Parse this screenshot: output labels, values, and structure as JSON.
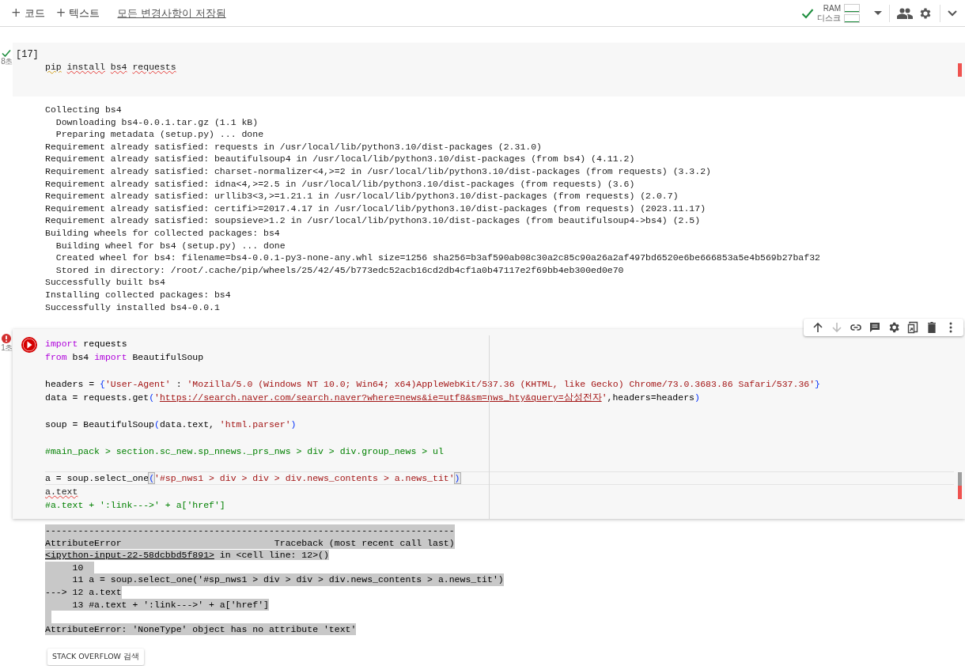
{
  "toolbar": {
    "buttons": [
      {
        "icon": "+",
        "label": "코드"
      },
      {
        "icon": "+",
        "label": "텍스트"
      }
    ],
    "save_status": "모든 변경사항이 저장됨",
    "resources": {
      "connected": true,
      "meters": [
        {
          "label": "RAM"
        },
        {
          "label": "디스크"
        }
      ]
    }
  },
  "cells": [
    {
      "failed": false,
      "time": "8초",
      "execution_count": "[17]",
      "run_button": false,
      "toolbar": false,
      "lines": [
        {
          "kind": "code",
          "current": false,
          "tokens": [
            {
              "kind": "warn",
              "text": "pip"
            },
            {
              "kind": "typo",
              "text": "install",
              "space_before": true
            },
            {
              "kind": "typo",
              "text": "bs4",
              "space_before": true
            },
            {
              "kind": "typo",
              "text": "requests",
              "space_before": true
            }
          ]
        }
      ],
      "output": {
        "kind": "stream",
        "lines": [
          "Collecting bs4",
          "  Downloading bs4-0.0.1.tar.gz (1.1 kB)",
          "  Preparing metadata (setup.py) ... done",
          "Requirement already satisfied: requests in /usr/local/lib/python3.10/dist-packages (2.31.0)",
          "Requirement already satisfied: beautifulsoup4 in /usr/local/lib/python3.10/dist-packages (from bs4) (4.11.2)",
          "Requirement already satisfied: charset-normalizer<4,>=2 in /usr/local/lib/python3.10/dist-packages (from requests) (3.3.2)",
          "Requirement already satisfied: idna<4,>=2.5 in /usr/local/lib/python3.10/dist-packages (from requests) (3.6)",
          "Requirement already satisfied: urllib3<3,>=1.21.1 in /usr/local/lib/python3.10/dist-packages (from requests) (2.0.7)",
          "Requirement already satisfied: certifi>=2017.4.17 in /usr/local/lib/python3.10/dist-packages (from requests) (2023.11.17)",
          "Requirement already satisfied: soupsieve>1.2 in /usr/local/lib/python3.10/dist-packages (from beautifulsoup4->bs4) (2.5)",
          "Building wheels for collected packages: bs4",
          "  Building wheel for bs4 (setup.py) ... done",
          "  Created wheel for bs4: filename=bs4-0.0.1-py3-none-any.whl size=1256 sha256=b3af590ab08c30a2c85c90a26a2af497bd6520e6be666853a5e4b569b27baf32",
          "  Stored in directory: /root/.cache/pip/wheels/25/42/45/b773edc52acb16cd2db4cf1a0b47117e2f69bb4eb300ed0e70",
          "Successfully built bs4",
          "Installing collected packages: bs4",
          "Successfully installed bs4-0.0.1"
        ]
      }
    },
    {
      "failed": true,
      "time": "1초",
      "run_button": true,
      "toolbar": true,
      "lines": [
        {
          "kind": "code",
          "current": false,
          "tokens": [
            {
              "kind": "kw",
              "text": "import"
            },
            {
              "kind": "plain",
              "text": " requests"
            }
          ]
        },
        {
          "kind": "code",
          "current": false,
          "tokens": [
            {
              "kind": "kw",
              "text": "from"
            },
            {
              "kind": "plain",
              "text": " bs4 "
            },
            {
              "kind": "kw",
              "text": "import"
            },
            {
              "kind": "plain",
              "text": " BeautifulSoup"
            }
          ]
        },
        {
          "kind": "blank"
        },
        {
          "kind": "code",
          "current": false,
          "tokens": [
            {
              "kind": "plain",
              "text": "headers = "
            },
            {
              "kind": "punct",
              "text": "{"
            },
            {
              "kind": "str",
              "text": "'User-Agent'"
            },
            {
              "kind": "plain",
              "text": " : "
            },
            {
              "kind": "str",
              "text": "'Mozilla/5.0 (Windows NT 10.0; Win64; x64)AppleWebKit/537.36 (KHTML, like Gecko) Chrome/73.0.3683.86 Safari/537.36'"
            },
            {
              "kind": "punct",
              "text": "}"
            }
          ]
        },
        {
          "kind": "code",
          "current": false,
          "tokens": [
            {
              "kind": "plain",
              "text": "data = requests.get"
            },
            {
              "kind": "punct",
              "text": "("
            },
            {
              "kind": "str",
              "text": "'"
            },
            {
              "kind": "url",
              "text": "https://search.naver.com/search.naver?where=news&ie=utf8&sm=nws_hty&query=삼성전자"
            },
            {
              "kind": "str",
              "text": "'"
            },
            {
              "kind": "plain",
              "text": ",headers=headers"
            },
            {
              "kind": "punct",
              "text": ")"
            }
          ]
        },
        {
          "kind": "blank"
        },
        {
          "kind": "code",
          "current": false,
          "tokens": [
            {
              "kind": "plain",
              "text": "soup = BeautifulSoup"
            },
            {
              "kind": "punct",
              "text": "("
            },
            {
              "kind": "plain",
              "text": "data.text, "
            },
            {
              "kind": "str",
              "text": "'html.parser'"
            },
            {
              "kind": "punct",
              "text": ")"
            }
          ]
        },
        {
          "kind": "blank"
        },
        {
          "kind": "code",
          "current": false,
          "tokens": [
            {
              "kind": "comment",
              "text": "#main_pack > section.sc_new.sp_nnews._prs_nws > div > div.group_news > ul"
            }
          ]
        },
        {
          "kind": "blank"
        },
        {
          "kind": "code",
          "current": true,
          "tokens": [
            {
              "kind": "plain",
              "text": "a = soup.select_one"
            },
            {
              "kind": "match",
              "text": "("
            },
            {
              "kind": "str",
              "text": "'#sp_nws1 > div > div > div.news_contents > a.news_tit'"
            },
            {
              "kind": "match",
              "text": ")"
            }
          ]
        },
        {
          "kind": "code",
          "current": false,
          "tokens": [
            {
              "kind": "typo",
              "text": "a.text"
            }
          ]
        },
        {
          "kind": "code",
          "current": false,
          "tokens": [
            {
              "kind": "comment",
              "text": "#a.text + ':link--->' + a['href']"
            }
          ]
        }
      ],
      "output": {
        "kind": "error",
        "lines": [
          {
            "kind": "code",
            "tokens": [
              {
                "kind": "plain",
                "text": "---------------------------------------------------------------------------"
              }
            ]
          },
          {
            "kind": "code",
            "tokens": [
              {
                "kind": "plain",
                "text": "AttributeError                            Traceback (most recent call last)"
              }
            ]
          },
          {
            "kind": "code",
            "tokens": [
              {
                "kind": "link",
                "text": "<ipython-input-22-58dcbbd5f891>"
              },
              {
                "kind": "plain",
                "text": " in <cell line: 12>()"
              }
            ]
          },
          {
            "kind": "code",
            "tokens": [
              {
                "kind": "plain",
                "text": "     10  "
              }
            ]
          },
          {
            "kind": "code",
            "tokens": [
              {
                "kind": "plain",
                "text": "     11 a = soup.select_one('#sp_nws1 > div > div > div.news_contents > a.news_tit')"
              }
            ]
          },
          {
            "kind": "code",
            "tokens": [
              {
                "kind": "plain",
                "text": "---> 12 a.text"
              }
            ]
          },
          {
            "kind": "code",
            "tokens": [
              {
                "kind": "plain",
                "text": "     13 #a.text + ':link--->' + a['href']"
              }
            ]
          },
          {
            "kind": "blank"
          },
          {
            "kind": "code",
            "tokens": [
              {
                "kind": "plain",
                "text": "AttributeError: 'NoneType' object has no attribute 'text'"
              }
            ]
          }
        ],
        "search_button": "STACK OVERFLOW 검색"
      },
      "cell_toolbar": [
        {
          "kind": "up",
          "disabled": false
        },
        {
          "kind": "down",
          "disabled": true
        },
        {
          "kind": "link",
          "disabled": false
        },
        {
          "kind": "comment",
          "disabled": false
        },
        {
          "kind": "settings",
          "disabled": false
        },
        {
          "kind": "mirror",
          "disabled": false
        },
        {
          "kind": "delete",
          "disabled": false
        },
        {
          "kind": "more",
          "disabled": false
        }
      ]
    }
  ]
}
